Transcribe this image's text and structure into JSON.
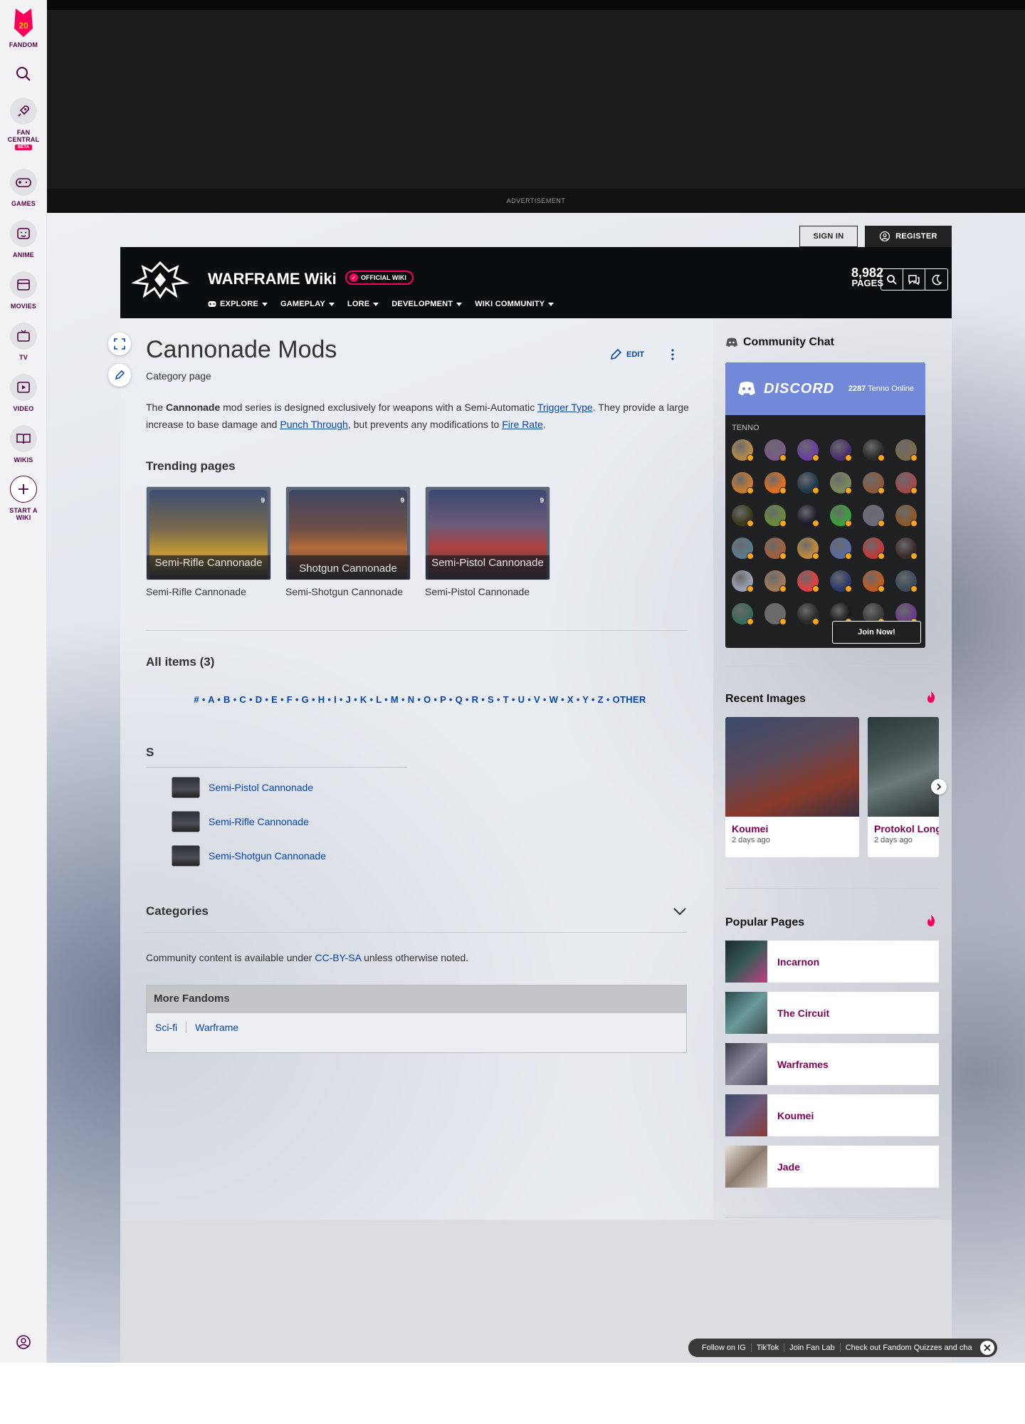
{
  "global_nav": {
    "logo_badge": "20",
    "logo_label": "FANDOM",
    "items": [
      {
        "label": "FAN\nCENTRAL",
        "badge": "BETA"
      },
      {
        "label": "GAMES"
      },
      {
        "label": "ANIME"
      },
      {
        "label": "MOVIES"
      },
      {
        "label": "TV"
      },
      {
        "label": "VIDEO"
      },
      {
        "label": "WIKIS"
      },
      {
        "label": "START A\nWIKI"
      }
    ]
  },
  "ad": {
    "label": "ADVERTISEMENT"
  },
  "auth": {
    "sign_in": "SIGN IN",
    "register": "REGISTER"
  },
  "wiki_header": {
    "title": "WARFRAME Wiki",
    "official_badge": "OFFICIAL WIKI",
    "nav": [
      "EXPLORE",
      "GAMEPLAY",
      "LORE",
      "DEVELOPMENT",
      "WIKI COMMUNITY"
    ],
    "page_count": "8,982",
    "page_count_label": "PAGES"
  },
  "article": {
    "title": "Cannonade Mods",
    "subtitle": "Category page",
    "edit_label": "EDIT",
    "intro": {
      "p1": "The ",
      "bold": "Cannonade",
      "p2": " mod series is designed exclusively for weapons with a Semi-Automatic ",
      "link1": "Trigger Type",
      "p3": ". They provide a large increase to base damage and ",
      "link2": "Punch Through",
      "p4": ", but prevents any modifications to ",
      "link3": "Fire Rate",
      "p5": "."
    },
    "trending_title": "Trending pages",
    "trending": [
      {
        "caption": "Semi-Rifle Cannonade",
        "label": "Semi-Rifle Cannonade",
        "badge": "9"
      },
      {
        "caption": "Shotgun Cannonade",
        "label": "Semi-Shotgun Cannonade",
        "badge": "9"
      },
      {
        "caption": "Semi-Pistol Cannonade",
        "label": "Semi-Pistol Cannonade",
        "badge": "9"
      }
    ],
    "all_items_title": "All items (3)",
    "alphabet": "# • A • B • C • D • E • F • G • H • I • J • K • L • M • N • O • P • Q • R • S • T • U • V • W • X • Y • Z • OTHER",
    "group_letter": "S",
    "items": [
      "Semi-Pistol Cannonade",
      "Semi-Rifle Cannonade",
      "Semi-Shotgun Cannonade"
    ],
    "categories_title": "Categories",
    "license_pre": "Community content is available under ",
    "license_link": "CC-BY-SA",
    "license_post": " unless otherwise noted.",
    "more_fandoms_title": "More Fandoms",
    "more_fandoms": [
      "Sci-fi",
      "Warframe"
    ]
  },
  "rail": {
    "community_chat_title": "Community Chat",
    "discord_word": "DISCORD",
    "online_count": "2287",
    "online_label": " Tenno Online",
    "tenno_label": "TENNO",
    "join_label": "Join Now!",
    "avatar_colors": [
      "#b5884a",
      "#7a5a8a",
      "#6b3fa0",
      "#4a2f6e",
      "#2a2a2a",
      "#7a6a50",
      "#a08a60",
      "#c87a30",
      "#e07020",
      "#1f3a4a",
      "#7a8a5a",
      "#8a5a3a",
      "#a04a4a",
      "#5a3a2a",
      "#3a3a1a",
      "#6a8a3a",
      "#1a1a2a",
      "#3aa03a",
      "#6a6a7a",
      "#8a5a2a",
      "#c0a030",
      "#5a7a8a",
      "#a0603a",
      "#c08a3a",
      "#5a6aa0",
      "#c03a3a",
      "#3a2a2a",
      "#c0b0a0",
      "#9aa0b0",
      "#a07a5a",
      "#e04040",
      "#2a3a6a",
      "#c05a20",
      "#3a4a5a",
      "#3a2a6a",
      "#3a6a5a",
      "#6a6a6a",
      "#2a2a2a",
      "#1a1a1a",
      "#3a3a3a",
      "#6a3a8a",
      "#4a4a4a"
    ],
    "recent_images_title": "Recent Images",
    "recent_images": [
      {
        "name": "Koumei",
        "time": "2 days ago"
      },
      {
        "name": "Protokol Long",
        "time": "2 days ago"
      }
    ],
    "popular_title": "Popular Pages",
    "popular": [
      "Incarnon",
      "The Circuit",
      "Warframes",
      "Koumei",
      "Jade"
    ]
  },
  "toast": {
    "items": [
      "Follow on IG",
      "TikTok",
      "Join Fan Lab",
      "Check out Fandom Quizzes and cha"
    ]
  }
}
